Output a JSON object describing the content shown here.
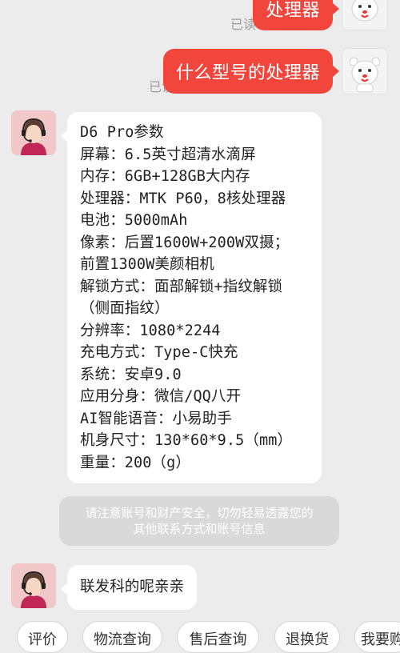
{
  "messages": {
    "out_1": {
      "text": "处理器",
      "status": "已读"
    },
    "out_2": {
      "text": "什么型号的处理器",
      "status": "已读"
    },
    "in_1": {
      "lines": [
        "D6 Pro参数",
        "屏幕：6.5英寸超清水滴屏",
        "内存：6GB+128GB大内存",
        "处理器：MTK P60，8核处理器",
        "电池：5000mAh",
        "像素：后置1600W+200W双摄；",
        "前置1300W美颜相机",
        "解锁方式：面部解锁+指纹解锁",
        "（侧面指纹）",
        "分辨率：1080*2244",
        "充电方式：Type-C快充",
        "系统：安卓9.0",
        "应用分身：微信/QQ八开",
        "AI智能语音：小易助手",
        "机身尺寸：130*60*9.5（mm）",
        "重量：200（g）"
      ]
    },
    "notice": {
      "line1": "请注意账号和财产安全，切勿轻易透露您的",
      "line2": "其他联系方式和账号信息"
    },
    "in_2": {
      "text": "联发科的呢亲亲"
    }
  },
  "quick_actions": [
    "评价",
    "物流查询",
    "售后查询",
    "退换货",
    "我要购"
  ],
  "icons": {
    "user_avatar": "dog-mascot-avatar",
    "agent_avatar": "headset-agent-avatar"
  },
  "colors": {
    "accent": "#f2463d"
  }
}
